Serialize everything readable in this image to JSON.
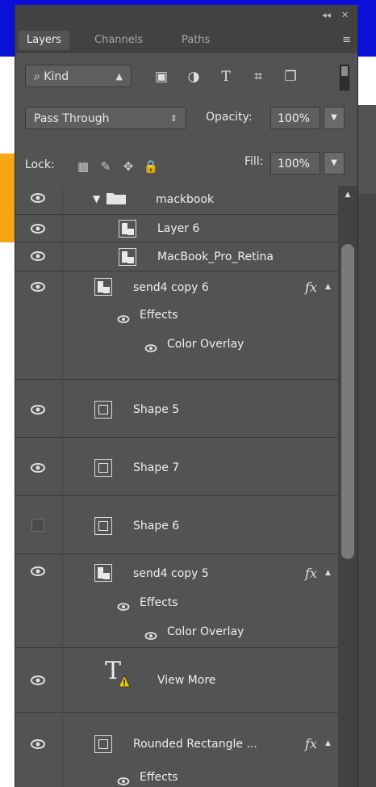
{
  "panel": {
    "collapse_glyph": "◂◂",
    "close_glyph": "✕",
    "menu_glyph": "≡",
    "tabs": [
      {
        "label": "Layers",
        "active": true
      },
      {
        "label": "Channels",
        "active": false
      },
      {
        "label": "Paths",
        "active": false
      }
    ]
  },
  "filter": {
    "kind_label": "Kind",
    "icons": [
      "image-filter-icon",
      "adjustment-filter-icon",
      "type-filter-icon",
      "shape-filter-icon",
      "smart-object-filter-icon"
    ]
  },
  "blend": {
    "mode": "Pass Through",
    "opacity_label": "Opacity:",
    "opacity_value": "100%"
  },
  "lock": {
    "label": "Lock:",
    "fill_label": "Fill:",
    "fill_value": "100%"
  },
  "layers": [
    {
      "name": "mackbook",
      "type": "group",
      "visible": true
    },
    {
      "name": "Layer 6",
      "type": "smart",
      "visible": true
    },
    {
      "name": "MacBook_Pro_Retina",
      "type": "smart",
      "visible": true
    },
    {
      "name": "send4 copy 6",
      "type": "smart",
      "visible": true,
      "fx": "fx",
      "effects_label": "Effects",
      "effect": "Color Overlay"
    },
    {
      "name": "Shape 5",
      "type": "shape",
      "visible": true
    },
    {
      "name": "Shape 7",
      "type": "shape",
      "visible": true
    },
    {
      "name": "Shape 6",
      "type": "shape",
      "visible": false
    },
    {
      "name": "send4 copy 5",
      "type": "smart",
      "visible": true,
      "fx": "fx",
      "effects_label": "Effects",
      "effect": "Color Overlay"
    },
    {
      "name": "View More",
      "type": "text",
      "visible": true
    },
    {
      "name": "Rounded Rectangle ...",
      "type": "shape",
      "visible": true,
      "fx": "fx",
      "effects_label": "Effects"
    }
  ]
}
